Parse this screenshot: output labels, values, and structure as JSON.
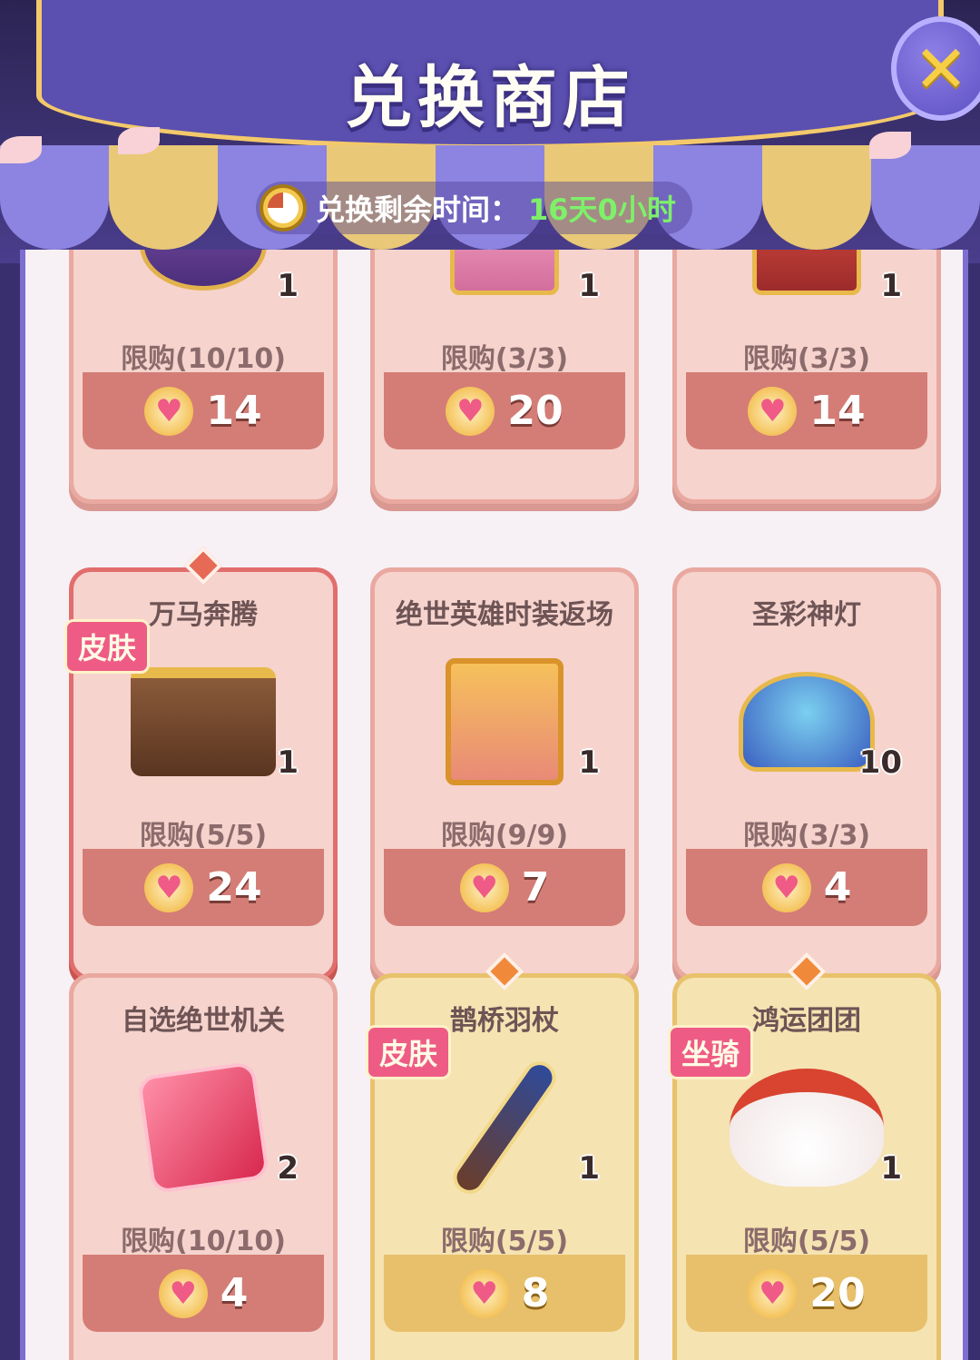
{
  "header": {
    "title": "兑换商店",
    "timer_label": "兑换剩余时间：",
    "timer_value": "16天0小时"
  },
  "colors": {
    "accent_green": "#7ef06a",
    "tag_pink": "#ee5c86",
    "price_red": "#d47d76",
    "price_gold": "#e8c06b"
  },
  "items": [
    {
      "name": "",
      "qty": "1",
      "limit": "限购(10/10)",
      "price": "14",
      "tag": "",
      "style": "pink",
      "icon": "purple-chest-icon"
    },
    {
      "name": "",
      "qty": "1",
      "limit": "限购(3/3)",
      "price": "20",
      "tag": "",
      "style": "pink",
      "icon": "pink-box-icon"
    },
    {
      "name": "",
      "qty": "1",
      "limit": "限购(3/3)",
      "price": "14",
      "tag": "",
      "style": "pink",
      "icon": "red-box-icon"
    },
    {
      "name": "万马奔腾",
      "qty": "1",
      "limit": "限购(5/5)",
      "price": "24",
      "tag": "皮肤",
      "style": "featured",
      "icon": "palace-skin-icon"
    },
    {
      "name": "绝世英雄时装返场",
      "qty": "1",
      "limit": "限购(9/9)",
      "price": "7",
      "tag": "",
      "style": "pink",
      "icon": "cat-mystery-box-icon"
    },
    {
      "name": "圣彩神灯",
      "qty": "10",
      "limit": "限购(3/3)",
      "price": "4",
      "tag": "",
      "style": "pink",
      "icon": "magic-lamp-icon"
    },
    {
      "name": "自选绝世机关",
      "qty": "2",
      "limit": "限购(10/10)",
      "price": "4",
      "tag": "",
      "style": "pink",
      "icon": "red-cube-icon"
    },
    {
      "name": "鹊桥羽杖",
      "qty": "1",
      "limit": "限购(5/5)",
      "price": "8",
      "tag": "皮肤",
      "style": "gold",
      "icon": "bird-staff-icon"
    },
    {
      "name": "鸿运团团",
      "qty": "1",
      "limit": "限购(5/5)",
      "price": "20",
      "tag": "坐骑",
      "style": "gold",
      "icon": "tiger-mount-icon"
    }
  ]
}
